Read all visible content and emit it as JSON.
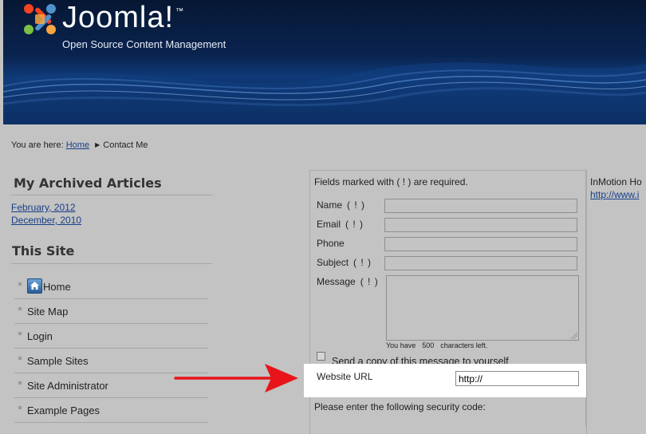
{
  "header": {
    "site_name": "Joomla!",
    "trademark": "™",
    "slogan": "Open Source Content Management"
  },
  "breadcrumb": {
    "prefix": "You are here:",
    "home": "Home",
    "current": "Contact Me"
  },
  "archive": {
    "title": "My Archived Articles",
    "items": [
      "February, 2012",
      "December, 2010"
    ]
  },
  "site_menu": {
    "title": "This Site",
    "items": [
      "Home",
      "Site Map",
      "Login",
      "Sample Sites",
      "Site Administrator",
      "Example Pages"
    ]
  },
  "contact_form": {
    "required_note": "Fields marked with ( ! ) are required.",
    "required_mark": "( ! )",
    "fields": {
      "name": "Name",
      "email": "Email",
      "phone": "Phone",
      "subject": "Subject",
      "message": "Message"
    },
    "chars_left": {
      "prefix": "You have",
      "count": "500",
      "suffix": "characters left."
    },
    "send_copy_label": "Send a copy of this message to yourself",
    "website_url_label": "Website URL",
    "website_url_value": "http://",
    "security_note": "Please enter the following security code:"
  },
  "right_column": {
    "text": "InMotion Ho",
    "link": "http://www.i"
  },
  "colors": {
    "background": "#c2c3c2",
    "link": "#1b3f8a",
    "arrow": "#e8141a",
    "banner": "#0a2450"
  }
}
